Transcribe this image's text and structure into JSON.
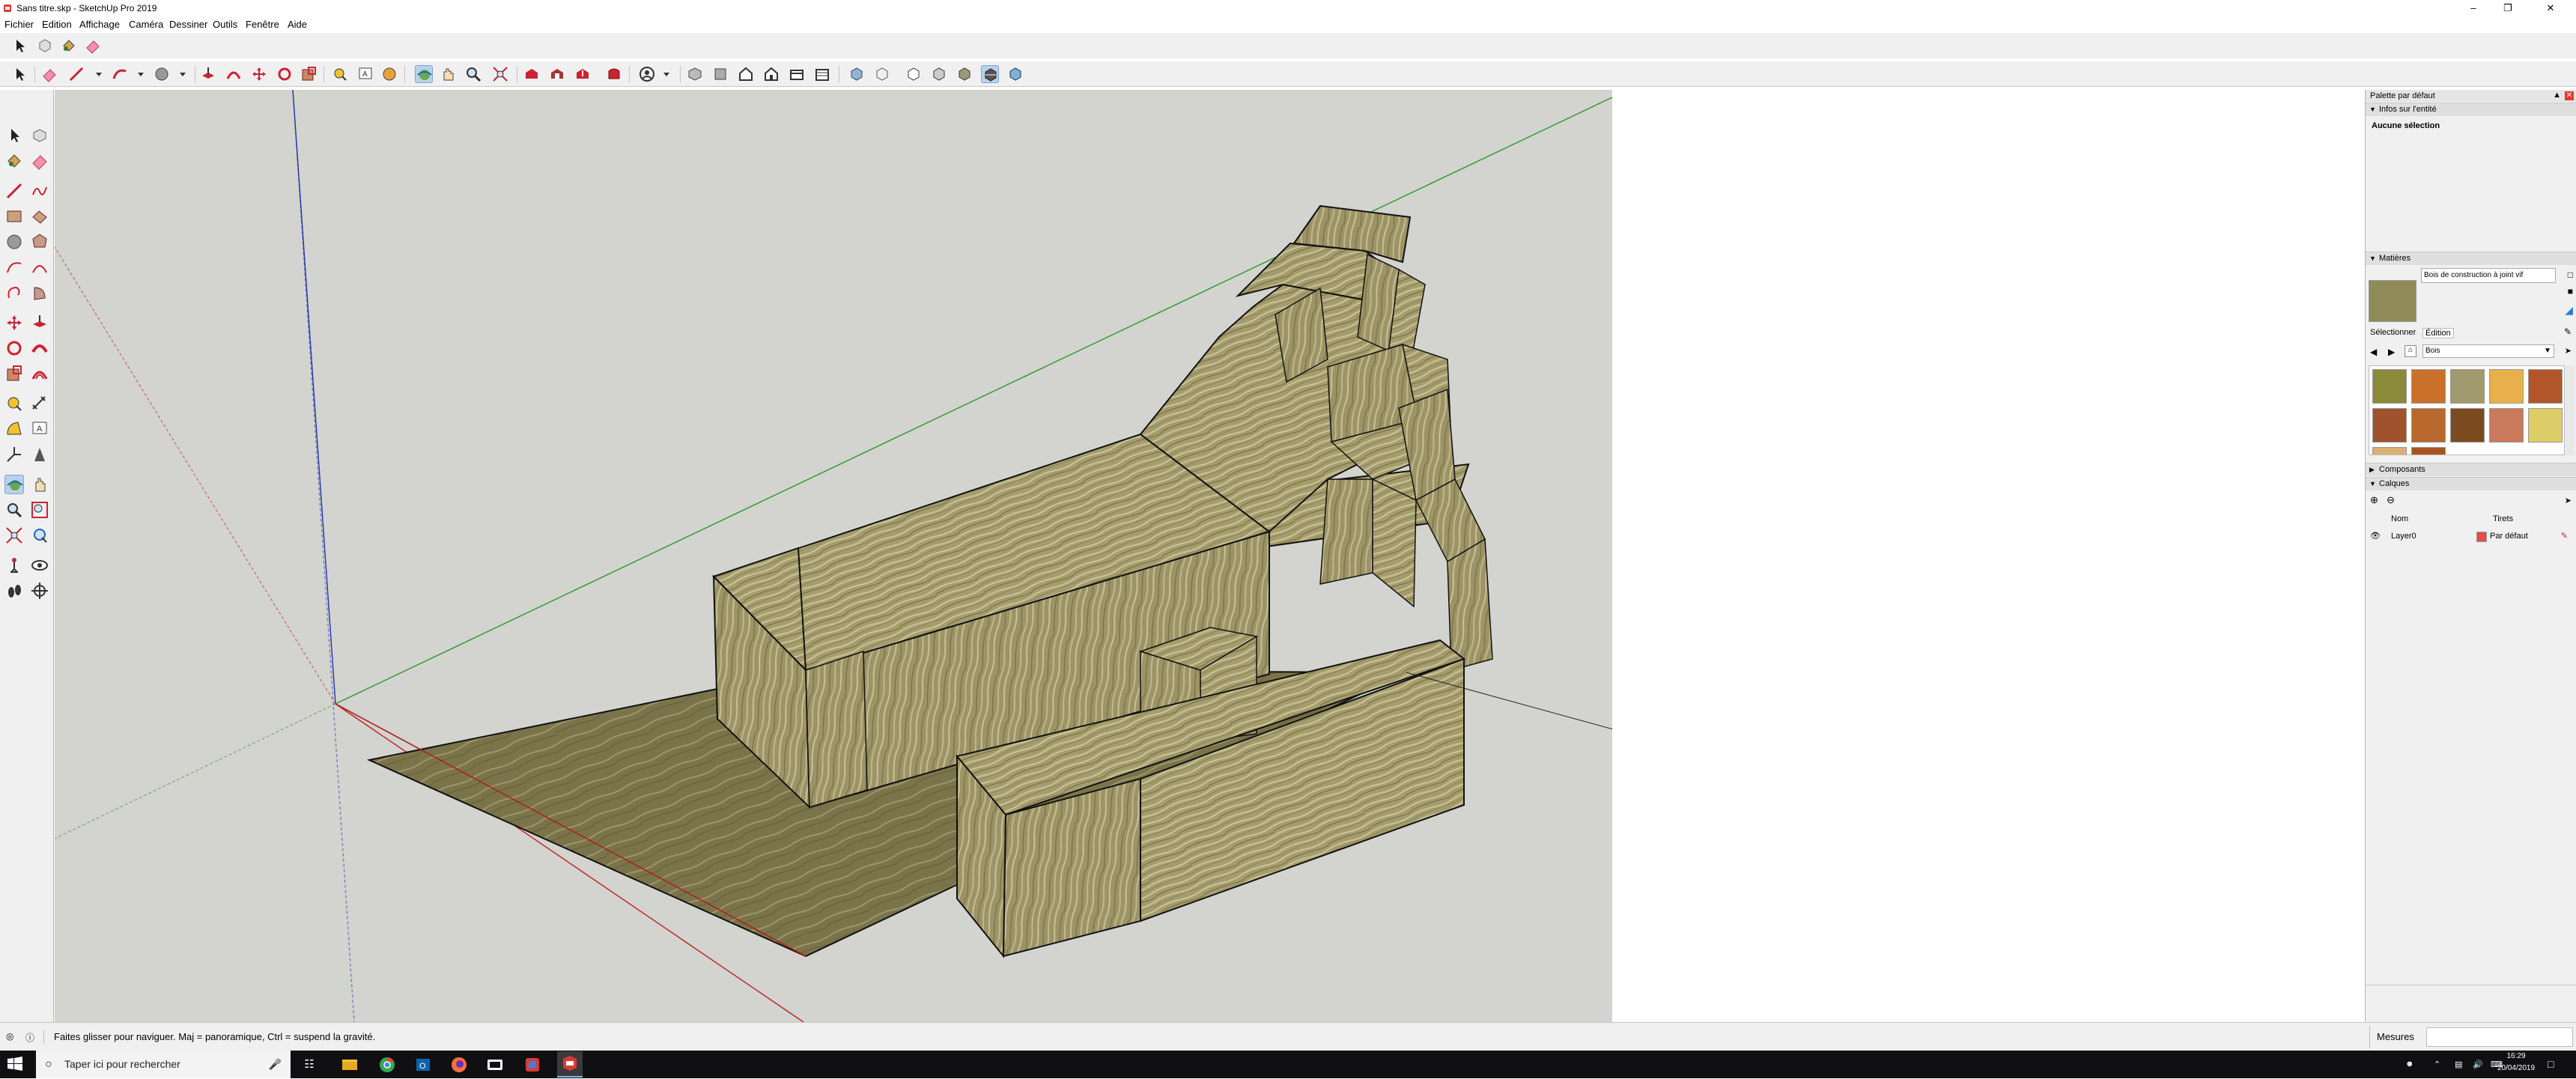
{
  "window": {
    "title": "Sans titre.skp - SketchUp Pro 2019"
  },
  "menu": [
    "Fichier",
    "Edition",
    "Affichage",
    "Caméra",
    "Dessiner",
    "Outils",
    "Fenêtre",
    "Aide"
  ],
  "right_panel": {
    "title": "Palette par défaut",
    "entity_info": {
      "header": "Infos sur l'entité",
      "status": "Aucune sélection"
    },
    "materials": {
      "header": "Matières",
      "current_name": "Bois de construction à joint vif",
      "tabs": [
        "Sélectionner",
        "Édition"
      ],
      "library": "Bois",
      "swatches": [
        "#8b8a3a",
        "#c9702a",
        "#a19a6e",
        "#e8b04a",
        "#b0562a",
        "#a0522d",
        "#b8682c",
        "#7b4a1e",
        "#c87a5a",
        "#dccd68",
        "#d9b070",
        "#a85420"
      ]
    },
    "components": {
      "header": "Composants"
    },
    "layers": {
      "header": "Calques",
      "col_name": "Nom",
      "col_dashes": "Tirets",
      "rows": [
        {
          "name": "Layer0",
          "dashes": "Par défaut",
          "color": "#e84c4c"
        }
      ]
    }
  },
  "status": {
    "hint": "Faites glisser pour naviguer. Maj = panoramique, Ctrl = suspend la gravité.",
    "measures_label": "Mesures"
  },
  "taskbar": {
    "search_placeholder": "Taper ici pour rechercher",
    "time": "16:29",
    "date": "20/04/2019"
  }
}
